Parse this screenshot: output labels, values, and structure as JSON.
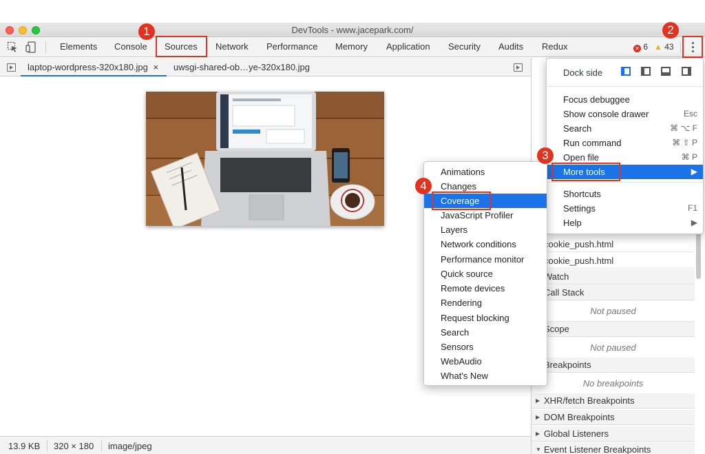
{
  "window": {
    "title": "DevTools - www.jacepark.com/"
  },
  "toolbar": {
    "tabs": [
      "Elements",
      "Console",
      "Sources",
      "Network",
      "Performance",
      "Memory",
      "Application",
      "Security",
      "Audits",
      "Redux"
    ],
    "errors": "6",
    "warnings": "43",
    "warn_symbol": "▲",
    "err_symbol": "✕"
  },
  "file_tabs": {
    "active": "laptop-wordpress-320x180.jpg",
    "close_symbol": "×",
    "other": "uwsgi-shared-ob…ye-320x180.jpg"
  },
  "status_bar": {
    "size": "13.9 KB",
    "dimensions": "320 × 180",
    "mime": "image/jpeg"
  },
  "right_pane": {
    "rows": [
      "cookie_push.html",
      "cookie_push.html",
      "Watch",
      "Call Stack",
      "Not paused",
      "Scope",
      "Not paused",
      "Breakpoints",
      "No breakpoints",
      "XHR/fetch Breakpoints",
      "DOM Breakpoints",
      "Global Listeners",
      "Event Listener Breakpoints"
    ]
  },
  "main_menu": {
    "dock_side_label": "Dock side",
    "items": [
      {
        "label": "Focus debuggee",
        "key": ""
      },
      {
        "label": "Show console drawer",
        "key": "Esc"
      },
      {
        "label": "Search",
        "key": "⌘ ⌥ F"
      },
      {
        "label": "Run command",
        "key": "⌘ ⇧ P"
      },
      {
        "label": "Open file",
        "key": "⌘ P"
      },
      {
        "label": "More tools",
        "key": "▶"
      },
      {
        "label": "Shortcuts",
        "key": ""
      },
      {
        "label": "Settings",
        "key": "F1"
      },
      {
        "label": "Help",
        "key": "▶"
      }
    ]
  },
  "more_tools_menu": {
    "items": [
      "Animations",
      "Changes",
      "Coverage",
      "JavaScript Profiler",
      "Layers",
      "Network conditions",
      "Performance monitor",
      "Quick source",
      "Remote devices",
      "Rendering",
      "Request blocking",
      "Search",
      "Sensors",
      "WebAudio",
      "What's New"
    ]
  },
  "annotations": {
    "n1": "1",
    "n2": "2",
    "n3": "3",
    "n4": "4"
  },
  "colors": {
    "accent": "#1a73e8",
    "callout": "#e3321f",
    "toolbar_bg": "#f3f3f3"
  }
}
